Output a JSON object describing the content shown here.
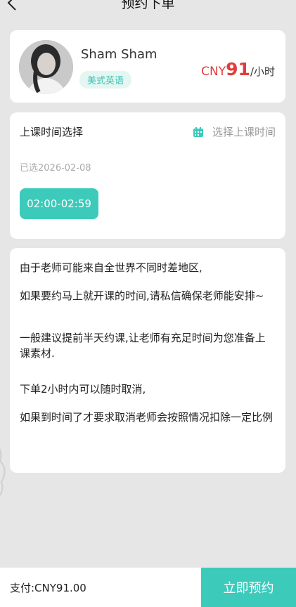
{
  "header": {
    "title": "预约下单",
    "back_icon": "chevron-left-icon"
  },
  "teacher": {
    "name": "Sham Sham",
    "tag": "美式英语",
    "price_currency": "CNY",
    "price_value": "91",
    "price_unit": "/小时"
  },
  "schedule": {
    "title": "上课时间选择",
    "picker_label": "选择上课时间",
    "picker_icon": "calendar-icon",
    "selected_date": "已选2026-02-08",
    "slots": [
      "02:00-02:59"
    ]
  },
  "notice": {
    "line1": "由于老师可能来自全世界不同时差地区,",
    "line2": "如果要约马上就开课的时间,请私信确保老师能安排~",
    "line3": "一般建议提前半天约课,让老师有充足时间为您准备上课素材.",
    "line4": "下单2小时内可以随时取消,",
    "line5": "如果到时间了才要求取消老师会按照情况扣除一定比例"
  },
  "footer": {
    "total": "支付:CNY91.00",
    "book_label": "立即预约"
  },
  "colors": {
    "accent": "#3ccabb",
    "price": "#e23c3c",
    "tag_bg": "#e3f6f2"
  }
}
